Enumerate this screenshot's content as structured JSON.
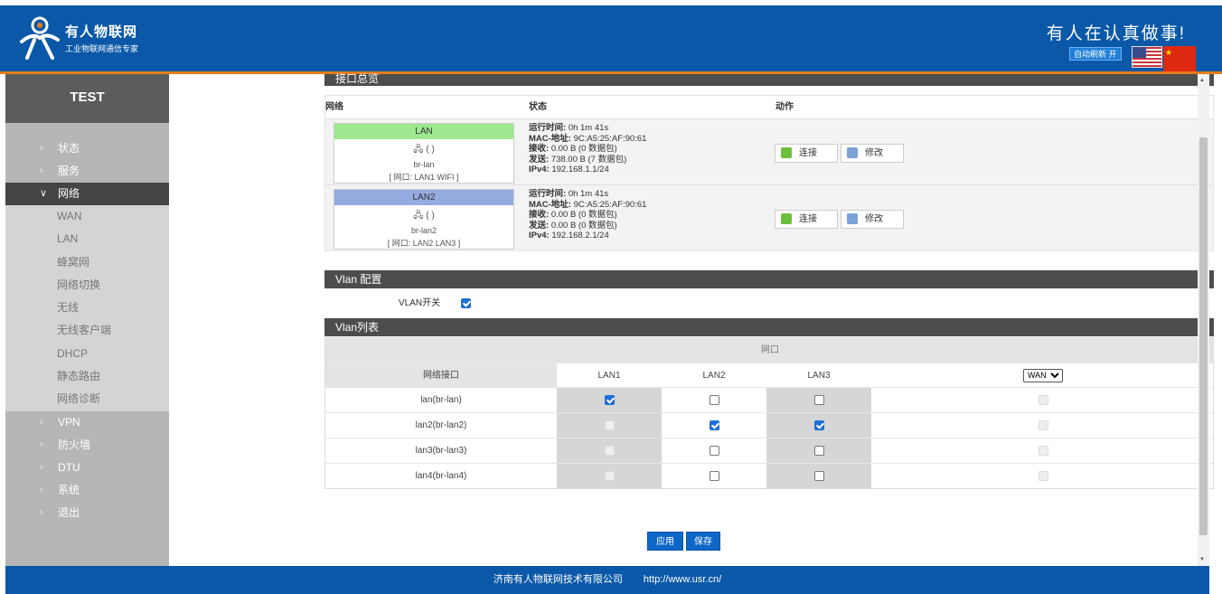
{
  "header": {
    "brand_name": "有人物联网",
    "brand_sub": "工业物联网通信专家",
    "slogan": "有人在认真做事!",
    "refresh_label": "自动刷新 开"
  },
  "sidebar": {
    "title": "TEST",
    "items_top": [
      {
        "label": "状态"
      },
      {
        "label": "服务"
      }
    ],
    "active": {
      "label": "网络"
    },
    "sub_items": [
      {
        "label": "WAN"
      },
      {
        "label": "LAN"
      },
      {
        "label": "蜂窝网"
      },
      {
        "label": "网络切换"
      },
      {
        "label": "无线"
      },
      {
        "label": "无线客户端"
      },
      {
        "label": "DHCP"
      },
      {
        "label": "静态路由"
      },
      {
        "label": "网络诊断"
      }
    ],
    "items_bottom": [
      {
        "label": "VPN"
      },
      {
        "label": "防火墙"
      },
      {
        "label": "DTU"
      },
      {
        "label": "系统"
      },
      {
        "label": "退出"
      }
    ]
  },
  "interfaces": {
    "section_title": "接口总览",
    "col_network": "网络",
    "col_status": "状态",
    "col_action": "动作",
    "rows": [
      {
        "name": "LAN",
        "color": "#9ee88f",
        "icons": "(  )",
        "device": "br-lan",
        "ports": "[ 网口: LAN1 WIFI ]",
        "uptime_label": "运行时间:",
        "uptime": "0h 1m 41s",
        "mac_label": "MAC-地址:",
        "mac": "9C:A5:25:AF:90:61",
        "rx_label": "接收:",
        "rx": "0.00 B (0 数据包)",
        "tx_label": "发送:",
        "tx": "738.00 B (7 数据包)",
        "ipv4_label": "IPv4:",
        "ipv4": "192.168.1.1/24",
        "connect_label": "连接",
        "edit_label": "修改"
      },
      {
        "name": "LAN2",
        "color": "#95abe0",
        "icons": "(  )",
        "device": "br-lan2",
        "ports": "[ 网口: LAN2 LAN3 ]",
        "uptime_label": "运行时间:",
        "uptime": "0h 1m 41s",
        "mac_label": "MAC-地址:",
        "mac": "9C:A5:25:AF:90:61",
        "rx_label": "接收:",
        "rx": "0.00 B (0 数据包)",
        "tx_label": "发送:",
        "tx": "0.00 B (0 数据包)",
        "ipv4_label": "IPv4:",
        "ipv4": "192.168.2.1/24",
        "connect_label": "连接",
        "edit_label": "修改"
      }
    ]
  },
  "vlan_config": {
    "section_title": "Vlan 配置",
    "switch_label": "VLAN开关",
    "switch_on": true
  },
  "vlan_list": {
    "section_title": "Vlan列表",
    "group_header": "网口",
    "col_iface": "网络接口",
    "cols": [
      "LAN1",
      "LAN2",
      "LAN3"
    ],
    "wan_select": "WAN",
    "rows": [
      {
        "iface": "lan(br-lan)",
        "cells": [
          "on",
          "off",
          "off",
          "dis"
        ]
      },
      {
        "iface": "lan2(br-lan2)",
        "cells": [
          "dis",
          "on",
          "on",
          "dis"
        ]
      },
      {
        "iface": "lan3(br-lan3)",
        "cells": [
          "dis",
          "off",
          "off",
          "dis"
        ]
      },
      {
        "iface": "lan4(br-lan4)",
        "cells": [
          "dis",
          "off",
          "off",
          "dis"
        ]
      }
    ]
  },
  "actions": {
    "apply_label": "应用",
    "save_label": "保存"
  },
  "footer": {
    "company": "济南有人物联网技术有限公司",
    "url": "http://www.usr.cn/"
  },
  "colors": {
    "header_blue": "#0b58a8",
    "accent_orange": "#e77b1e",
    "button_blue": "#0e67c8",
    "checkbox_blue": "#1f6fd6"
  }
}
